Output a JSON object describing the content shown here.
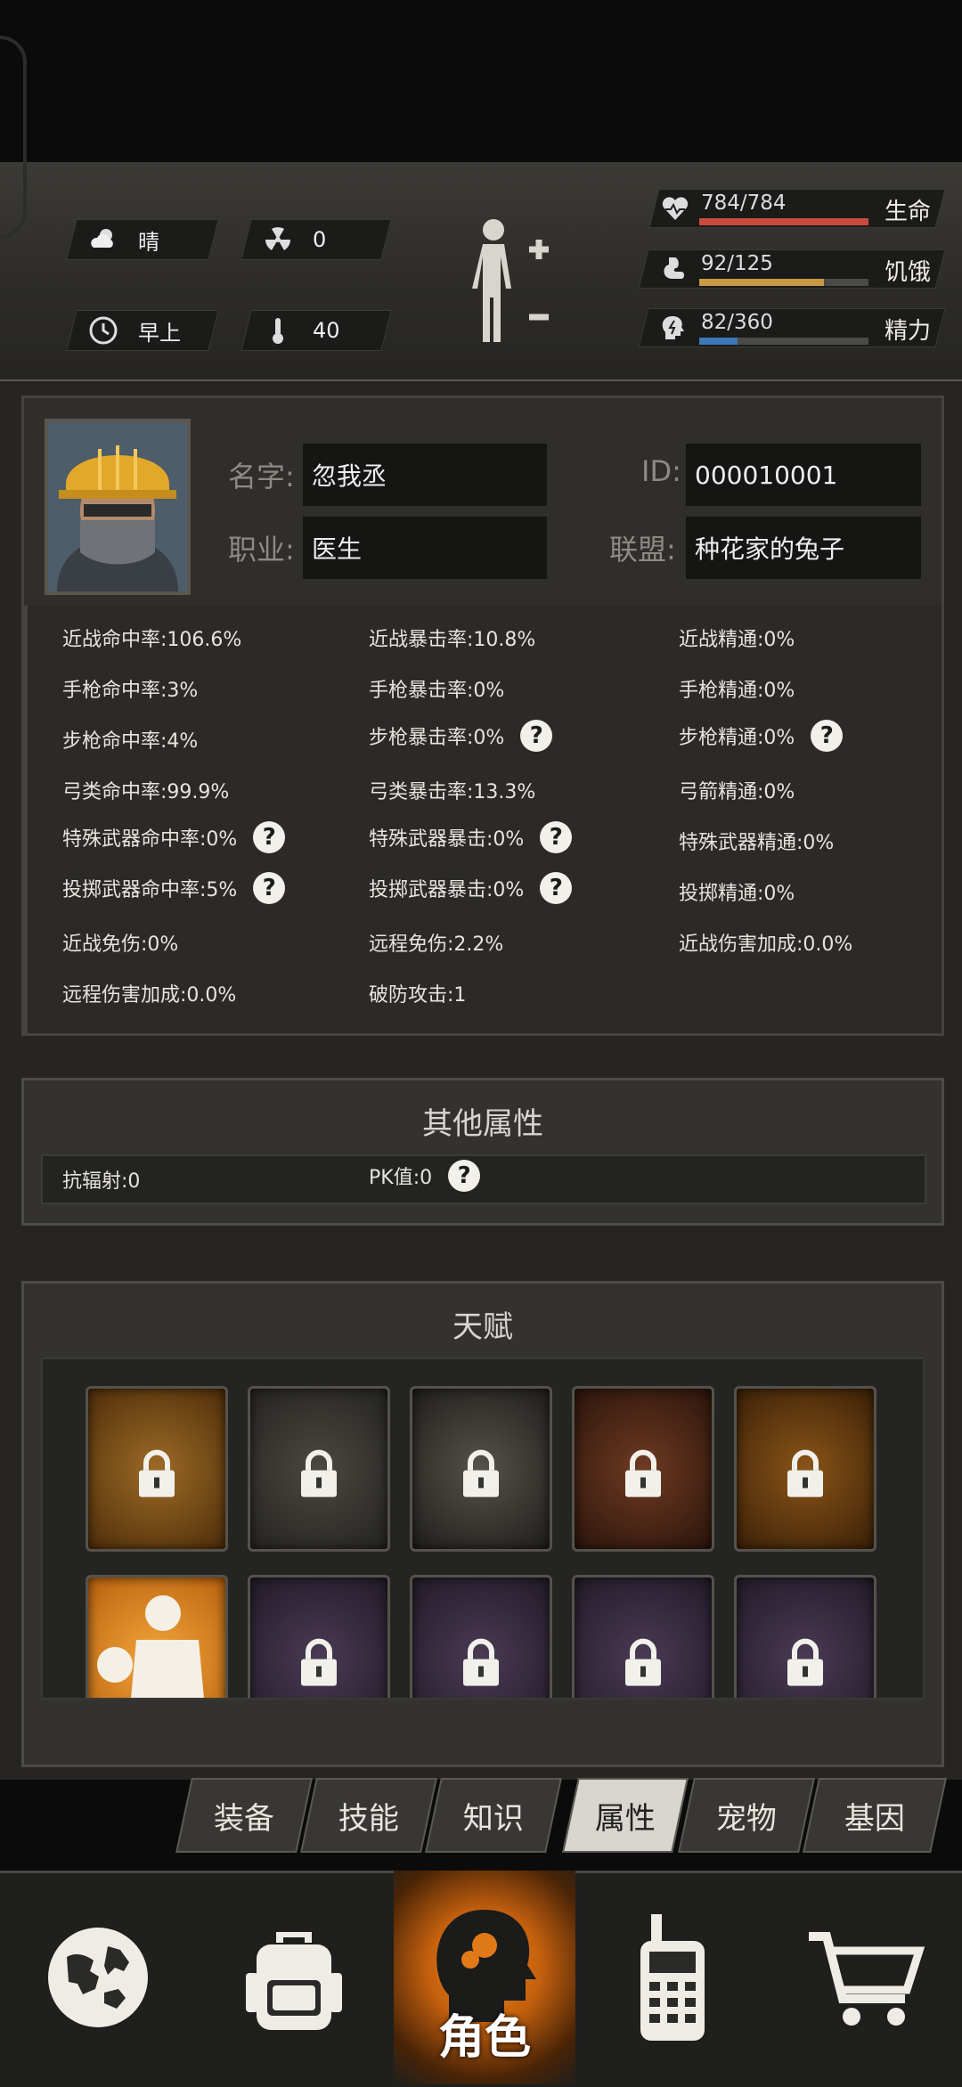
{
  "hud": {
    "weather": "晴",
    "radiation": "0",
    "time_of_day": "早上",
    "temperature": "40",
    "health": {
      "value": "784/784",
      "label": "生命",
      "fraction": 1.0,
      "color": "#c84b3b"
    },
    "hunger": {
      "value": "92/125",
      "label": "饥饿",
      "fraction": 0.736,
      "color": "#c79a43"
    },
    "energy": {
      "value": "82/360",
      "label": "精力",
      "fraction": 0.228,
      "color": "#3c79b8"
    }
  },
  "profile": {
    "name_label": "名字:",
    "name": "忽我丞",
    "id_label": "ID:",
    "id": "000010001",
    "job_label": "职业:",
    "job": "医生",
    "alliance_label": "联盟:",
    "alliance": "种花家的兔子"
  },
  "stats": [
    [
      "近战命中率:106.6%",
      "近战暴击率:10.8%",
      "近战精通:0%"
    ],
    [
      "手枪命中率:3%",
      "手枪暴击率:0%",
      "手枪精通:0%"
    ],
    [
      "步枪命中率:4%",
      "步枪暴击率:0%",
      "步枪精通:0%"
    ],
    [
      "弓类命中率:99.9%",
      "弓类暴击率:13.3%",
      "弓箭精通:0%"
    ],
    [
      "特殊武器命中率:0%",
      "特殊武器暴击:0%",
      "特殊武器精通:0%"
    ],
    [
      "投掷武器命中率:5%",
      "投掷武器暴击:0%",
      "投掷精通:0%"
    ],
    [
      "近战免伤:0%",
      "远程免伤:2.2%",
      "近战伤害加成:0.0%"
    ],
    [
      "远程伤害加成:0.0%",
      "破防攻击:1",
      ""
    ]
  ],
  "other": {
    "title": "其他属性",
    "radiation_resist": "抗辐射:0",
    "pk_value": "PK值:0"
  },
  "talent": {
    "title": "天赋"
  },
  "tabs": [
    "装备",
    "技能",
    "知识",
    "属性",
    "宠物",
    "基因"
  ],
  "active_tab": "属性",
  "nav": {
    "active_label": "角色"
  },
  "colors": {
    "accent_orange": "#e07a18",
    "panel": "#2d2c29"
  }
}
